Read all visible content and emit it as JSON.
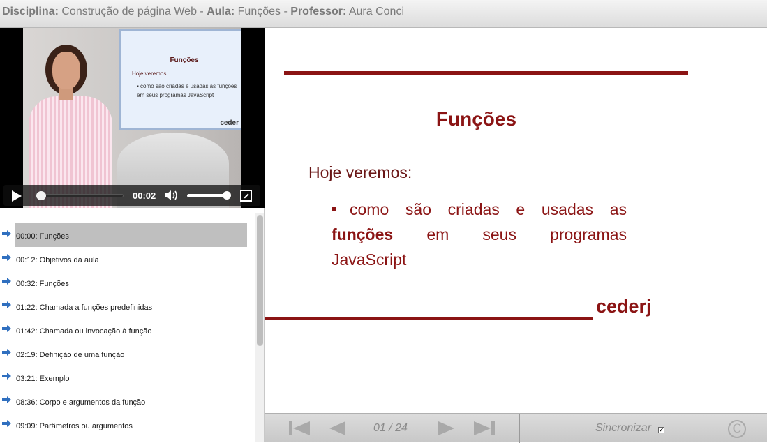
{
  "header": {
    "discipline_label": "Disciplina:",
    "discipline_value": "Construção de página Web",
    "lesson_label": "Aula:",
    "lesson_value": "Funções",
    "professor_label": "Professor:",
    "professor_value": "Aura Conci",
    "separator": "-"
  },
  "video": {
    "screen_title": "Funções",
    "screen_subtitle": "Hoje veremos:",
    "screen_bullet": "▪ como são criadas e usadas as funções em seus programas JavaScript",
    "screen_logo": "ceder",
    "current_time": "00:02",
    "progress": 0.03,
    "volume": 0.85,
    "icons": {
      "play": "play-icon",
      "volume": "volume-icon",
      "fullscreen": "fullscreen-icon"
    }
  },
  "chapters": [
    {
      "label": "00:00: Funções",
      "active": true
    },
    {
      "label": "00:12: Objetivos da aula",
      "active": false
    },
    {
      "label": "00:32: Funções",
      "active": false
    },
    {
      "label": "01:22: Chamada a funções predefinidas",
      "active": false
    },
    {
      "label": "01:42: Chamada ou invocação à função",
      "active": false
    },
    {
      "label": "02:19: Definição de uma função",
      "active": false
    },
    {
      "label": "03:21: Exemplo",
      "active": false
    },
    {
      "label": "08:36: Corpo e argumentos da função",
      "active": false
    },
    {
      "label": "09:09: Parâmetros ou argumentos",
      "active": false
    }
  ],
  "slide": {
    "title": "Funções",
    "subtitle": "Hoje veremos:",
    "bullet_line1": "como são criadas e usadas as",
    "bullet_bold": "funções",
    "bullet_line2_rest": "em seus programas",
    "bullet_line3": "JavaScript",
    "logo": "cederj"
  },
  "nav": {
    "page_indicator": "01 / 24",
    "sync_label": "Sincronizar",
    "sync_checked": true,
    "copyright_symbol": "C"
  },
  "colors": {
    "accent": "#8b1414",
    "active_item": "#bfbfbf",
    "nav_icon": "#a9a9a9",
    "chapter_arrow": "#2f6fbf"
  }
}
